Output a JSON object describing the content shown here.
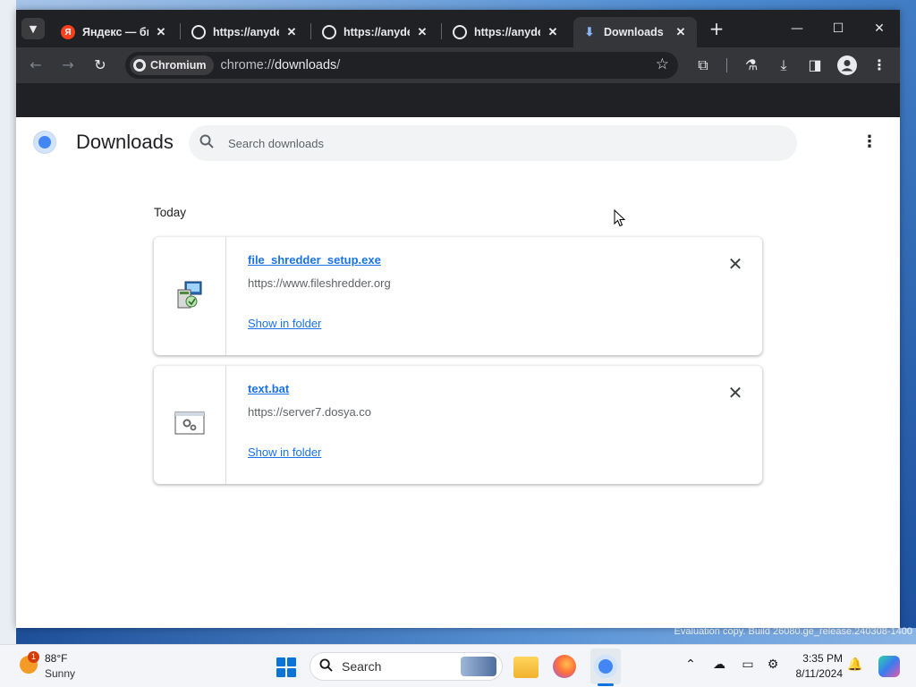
{
  "desktop": {
    "watermark": "Evaluation copy. Build 26080.ge_release.240308-1400"
  },
  "browser": {
    "tabs": [
      {
        "label": "Яндекс — быстрый",
        "favicon": "yandex-icon",
        "active": false
      },
      {
        "label": "https://anydesk",
        "favicon": "globe-icon",
        "active": false
      },
      {
        "label": "https://anydesk",
        "favicon": "globe-icon",
        "active": false
      },
      {
        "label": "https://anydesk",
        "favicon": "globe-icon",
        "active": false
      },
      {
        "label": "Downloads",
        "favicon": "download-icon",
        "active": true
      }
    ],
    "new_tab_symbol": "+",
    "window_controls": {
      "minimize": "—",
      "maximize": "☐",
      "close": "✕"
    },
    "omnibox": {
      "chip_label": "Chromium",
      "scheme": "chrome://",
      "host": "downloads",
      "path": "/"
    },
    "accent": "#1a73e8"
  },
  "page": {
    "title": "Downloads",
    "search_placeholder": "Search downloads",
    "section_label": "Today",
    "downloads": [
      {
        "filename": "file_shredder_setup.exe",
        "url": "https://www.fileshredder.org",
        "action": "Show in folder",
        "icon": "installer-icon"
      },
      {
        "filename": "text.bat",
        "url": "https://server7.dosya.co",
        "action": "Show in folder",
        "icon": "batch-file-icon"
      }
    ]
  },
  "taskbar": {
    "weather": {
      "temp": "88°F",
      "desc": "Sunny",
      "badge": "1"
    },
    "search_label": "Search",
    "clock": {
      "time": "3:35 PM",
      "date": "8/11/2024"
    }
  }
}
